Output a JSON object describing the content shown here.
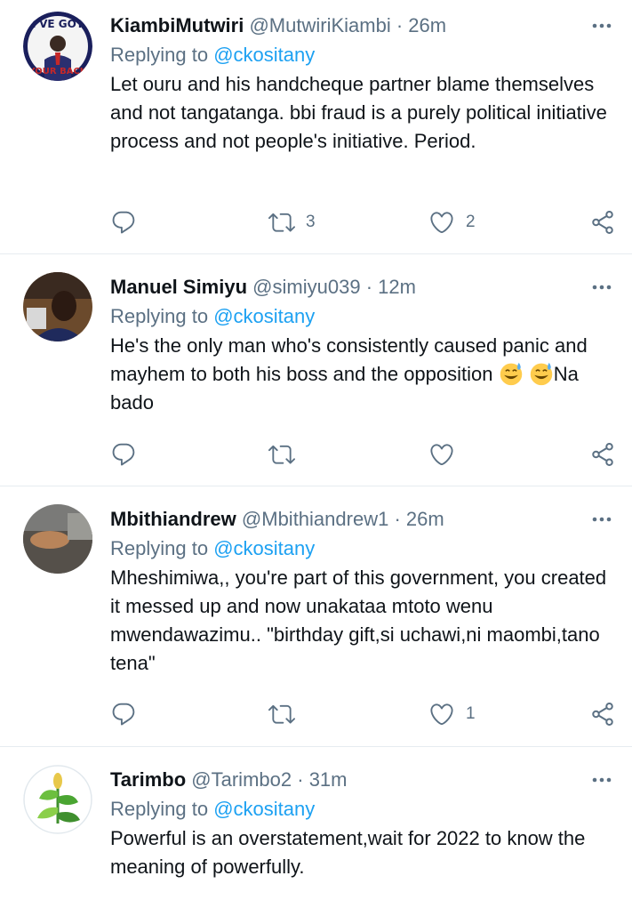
{
  "replying_prefix": "Replying to ",
  "tweets": [
    {
      "name": "KiambiMutwiri",
      "handle": "@MutwiriKiambi",
      "time": "26m",
      "replying_to": "@ckositany",
      "avatar_text_top": "I'VE GOT",
      "avatar_text_bottom": "YOUR BACK",
      "text": "Let ouru and his handcheque partner blame themselves and not tangatanga. bbi fraud is a purely political initiative process and not people's initiative. Period.",
      "retweets": "3",
      "likes": "2",
      "replies": ""
    },
    {
      "name": "Manuel Simiyu",
      "handle": "@simiyu039",
      "time": "12m",
      "replying_to": "@ckositany",
      "text_a": "He's the only man who's consistently caused panic and mayhem to both his boss and the opposition ",
      "text_b": "Na bado",
      "emoji": "grinning-face-with-sweat",
      "retweets": "",
      "likes": "",
      "replies": ""
    },
    {
      "name": "Mbithiandrew",
      "handle": "@Mbithiandrew1",
      "time": "26m",
      "replying_to": "@ckositany",
      "text": "Mheshimiwa,, you're part of this government, you created it messed up and now unakataa mtoto wenu mwendawazimu.. \"birthday gift,si uchawi,ni maombi,tano tena\"",
      "retweets": "",
      "likes": "1",
      "replies": ""
    },
    {
      "name": "Tarimbo",
      "handle": "@Tarimbo2",
      "time": "31m",
      "replying_to": "@ckositany",
      "text": "Powerful is an overstatement,wait for 2022 to know the meaning of powerfully."
    }
  ],
  "colors": {
    "link": "#1da1f2",
    "secondary": "#5b7083",
    "divider": "#e6ecf0"
  }
}
